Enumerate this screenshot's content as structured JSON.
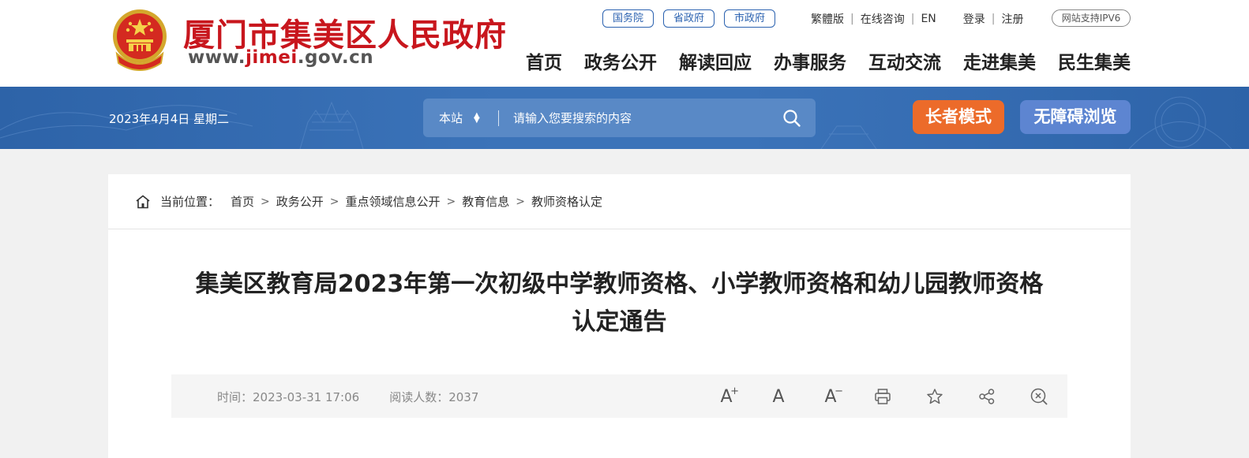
{
  "header": {
    "site_title": "厦门市集美区人民政府",
    "site_url": {
      "prefix": "www.",
      "highlight": "jimei",
      "suffix": ".gov.cn"
    },
    "emblem_icon": "national-emblem-icon",
    "gov_links": [
      "国务院",
      "省政府",
      "市政府"
    ],
    "top_links": {
      "traditional": "繁體版",
      "consult": "在线咨询",
      "english": "EN",
      "login": "登录",
      "register": "注册"
    },
    "ipv6_badge": "网站支持IPV6",
    "nav": [
      "首页",
      "政务公开",
      "解读回应",
      "办事服务",
      "互动交流",
      "走进集美",
      "民生集美"
    ]
  },
  "banner": {
    "date": "2023年4月4日 星期二",
    "search": {
      "scope": "本站",
      "placeholder": "请输入您要搜索的内容",
      "icon": "search-icon"
    },
    "elder_mode": "长者模式",
    "accessible_mode": "无障碍浏览",
    "colors": {
      "banner": "#3b73b9",
      "elder": "#ec6b2a",
      "access": "#5d85d1"
    }
  },
  "breadcrumb": {
    "label": "当前位置：",
    "items": [
      "首页",
      "政务公开",
      "重点领域信息公开",
      "教育信息",
      "教师资格认定"
    ],
    "separator": ">"
  },
  "article": {
    "title_line1": "集美区教育局2023年第一次初级中学教师资格、小学教师资格和幼儿园教师资格",
    "title_line2": "认定通告",
    "time_label": "时间：",
    "time_value": "2023-03-31 17:06",
    "views_label": "阅读人数：",
    "views_value": "2037",
    "tools": [
      "font-increase-icon",
      "font-default-icon",
      "font-decrease-icon",
      "print-icon",
      "favorite-star-icon",
      "share-icon",
      "close-circle-icon"
    ],
    "font_glyph": "A"
  },
  "colors": {
    "brand_red": "#c8161d",
    "link_blue": "#2b62b0"
  }
}
